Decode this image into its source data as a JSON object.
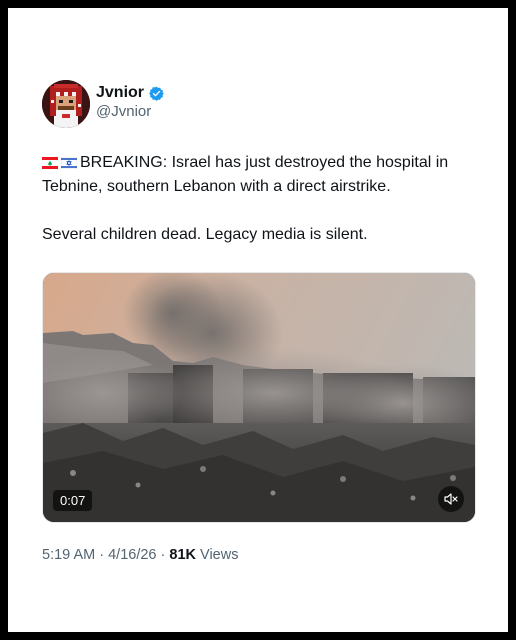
{
  "post": {
    "author": {
      "display_name": "Jvnior",
      "handle": "@Jvnior",
      "verified": true,
      "avatar_icon": "pixel-art-avatar"
    },
    "flags": [
      "lebanon-flag-icon",
      "israel-flag-icon"
    ],
    "text_line1": "BREAKING: Israel has just destroyed the hospital in Tebnine, southern Lebanon with a direct airstrike.",
    "text_line2": "Several children dead. Legacy media is silent.",
    "media": {
      "type": "video",
      "duration": "0:07",
      "muted_icon": "volume-mute-icon"
    },
    "time": "5:19 AM",
    "date": "4/16/26",
    "views_count": "81K",
    "views_label": "Views",
    "separator": "·"
  },
  "colors": {
    "verified": "#1d9bf0",
    "text": "#0f1419",
    "muted_text": "#536471"
  }
}
